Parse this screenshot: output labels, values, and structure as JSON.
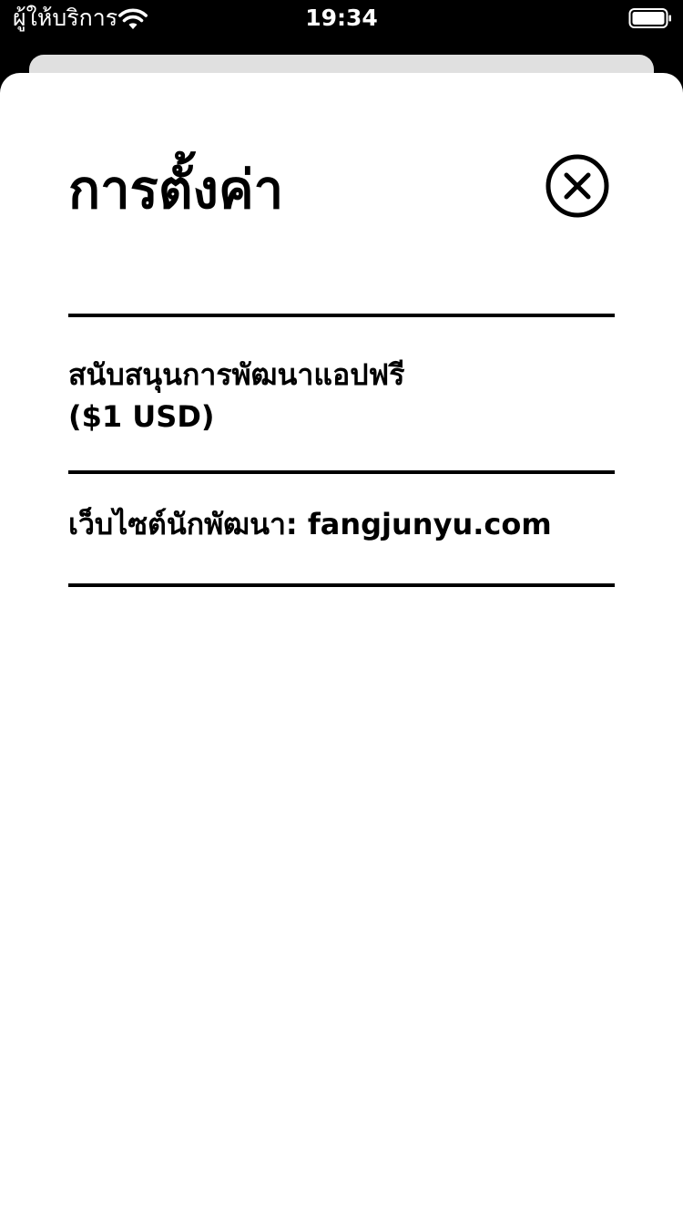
{
  "status_bar": {
    "carrier": "ผู้ให้บริการ",
    "time": "19:34",
    "wifi_icon": "wifi-icon",
    "battery_icon": "battery-icon"
  },
  "sheet": {
    "title": "การตั้งค่า",
    "close_icon": "close-circle-icon"
  },
  "settings": {
    "items": [
      {
        "line1": "สนับสนุนการพัฒนาแอปฟรี",
        "line2": "($1 USD)"
      },
      {
        "label": "เว็บไซต์นักพัฒนา: fangjunyu.com"
      }
    ]
  },
  "colors": {
    "background": "#000000",
    "sheet": "#ffffff",
    "back_sheet": "#e0e0e0",
    "text": "#000000",
    "status_text": "#ffffff"
  }
}
